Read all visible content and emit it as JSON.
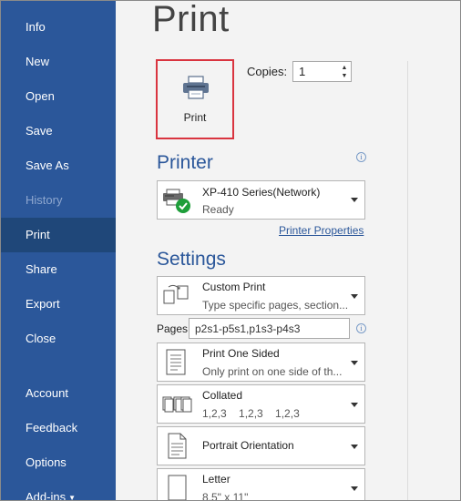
{
  "sidebar": {
    "items": [
      {
        "label": "Info"
      },
      {
        "label": "New"
      },
      {
        "label": "Open"
      },
      {
        "label": "Save"
      },
      {
        "label": "Save As"
      },
      {
        "label": "History"
      },
      {
        "label": "Print"
      },
      {
        "label": "Share"
      },
      {
        "label": "Export"
      },
      {
        "label": "Close"
      },
      {
        "label": "Account"
      },
      {
        "label": "Feedback"
      },
      {
        "label": "Options"
      },
      {
        "label": "Add-ins"
      }
    ],
    "active": "Print",
    "disabled": "History"
  },
  "main": {
    "title": "Print",
    "print_button_label": "Print",
    "copies_label": "Copies:",
    "copies_value": "1",
    "printer_heading": "Printer",
    "printer": {
      "name": "XP-410 Series(Network)",
      "status": "Ready"
    },
    "printer_properties_link": "Printer Properties",
    "settings_heading": "Settings",
    "settings": {
      "range": {
        "title": "Custom Print",
        "subtitle": "Type specific pages, section..."
      },
      "pages_label": "Pages:",
      "pages_value": "p2s1-p5s1,p1s3-p4s3",
      "sides": {
        "title": "Print One Sided",
        "subtitle": "Only print on one side of th..."
      },
      "collation": {
        "title": "Collated",
        "subtitle": "1,2,3    1,2,3    1,2,3"
      },
      "orientation": {
        "title": "Portrait Orientation"
      },
      "paper": {
        "title": "Letter",
        "subtitle": "8.5\" x 11\""
      }
    }
  },
  "colors": {
    "sidebar": "#2b579a",
    "sidebar_active": "#1f4779",
    "accent": "#2b579a",
    "print_highlight": "#d9343f"
  }
}
